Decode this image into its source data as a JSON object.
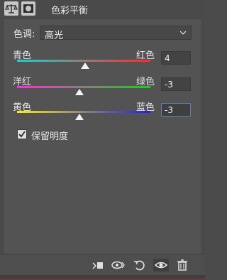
{
  "header": {
    "title": "色彩平衡",
    "icon_1": "balance-scale-icon",
    "icon_2": "layer-mask-icon"
  },
  "tone": {
    "label": "色调:",
    "value": "高光"
  },
  "sliders": [
    {
      "left_label": "青色",
      "right_label": "红色",
      "value": "4",
      "colors": [
        "#1bd0d0",
        "#ff2a2a"
      ]
    },
    {
      "left_label": "洋红",
      "right_label": "绿色",
      "value": "-3",
      "colors": [
        "#ff2be0",
        "#17d017"
      ]
    },
    {
      "left_label": "黄色",
      "right_label": "蓝色",
      "value": "-3",
      "colors": [
        "#ffee00",
        "#1b1bff"
      ]
    }
  ],
  "preserve_luminosity": {
    "label": "保留明度",
    "checked": true
  },
  "footer": {
    "buttons": [
      "clip-to-layer-icon",
      "view-previous-icon",
      "reset-icon",
      "visibility-eye-icon",
      "trash-icon"
    ]
  }
}
